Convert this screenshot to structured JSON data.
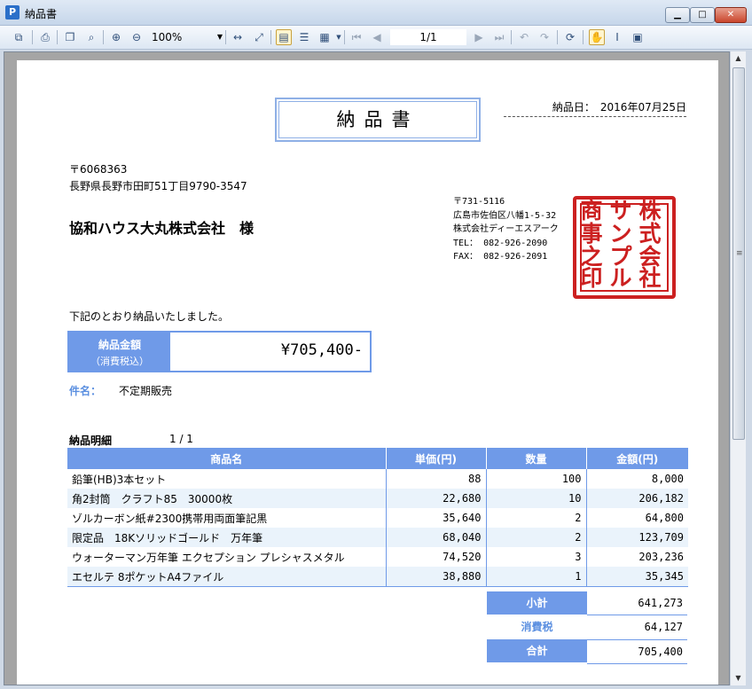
{
  "window": {
    "title": "納品書",
    "app_icon": "P"
  },
  "toolbar": {
    "zoom": "100%",
    "page_indicator": "1/1"
  },
  "document": {
    "title": "納品書",
    "date_label": "納品日：",
    "date_value": "2016年07月25日",
    "recipient": {
      "postal": "〒6068363",
      "address": "長野県長野市田町51丁目9790-3547",
      "name": "協和ハウス大丸株式会社　様"
    },
    "sender": {
      "postal": "〒731-5116",
      "address": "広島市佐伯区八幡1-5-32",
      "company": "株式会社ディーエスアーク",
      "tel": "TEL： 082-926-2090",
      "fax": "FAX： 082-926-2091"
    },
    "stamp_chars": [
      "株",
      "式",
      "会",
      "社",
      "サ",
      "ン",
      "プ",
      "ル",
      "商",
      "事",
      "之",
      "印"
    ],
    "intro": "下記のとおり納品いたしました。",
    "amount_label": "納品金額",
    "amount_sublabel": "（消費税込）",
    "amount_value": "¥705,400-",
    "subject_label": "件名：",
    "subject_value": "不定期販売",
    "detail_title": "納品明細",
    "detail_page": "1 / 1",
    "columns": [
      "商品名",
      "単価(円)",
      "数量",
      "金額(円)"
    ],
    "rows": [
      {
        "name": "鉛筆(HB)3本セット",
        "price": "88",
        "qty": "100",
        "amount": "8,000"
      },
      {
        "name": "角2封筒　クラフト85　30000枚",
        "price": "22,680",
        "qty": "10",
        "amount": "206,182"
      },
      {
        "name": "ゾルカーボン紙#2300携帯用両面筆記黒",
        "price": "35,640",
        "qty": "2",
        "amount": "64,800"
      },
      {
        "name": "限定品　18Kソリッドゴールド　万年筆",
        "price": "68,040",
        "qty": "2",
        "amount": "123,709"
      },
      {
        "name": "ウォーターマン万年筆 エクセプション プレシャスメタル",
        "price": "74,520",
        "qty": "3",
        "amount": "203,236"
      },
      {
        "name": "エセルテ 8ポケットA4ファイル",
        "price": "38,880",
        "qty": "1",
        "amount": "35,345"
      }
    ],
    "totals": {
      "subtotal_label": "小計",
      "subtotal_value": "641,273",
      "tax_label": "消費税",
      "tax_value": "64,127",
      "total_label": "合計",
      "total_value": "705,400"
    }
  }
}
